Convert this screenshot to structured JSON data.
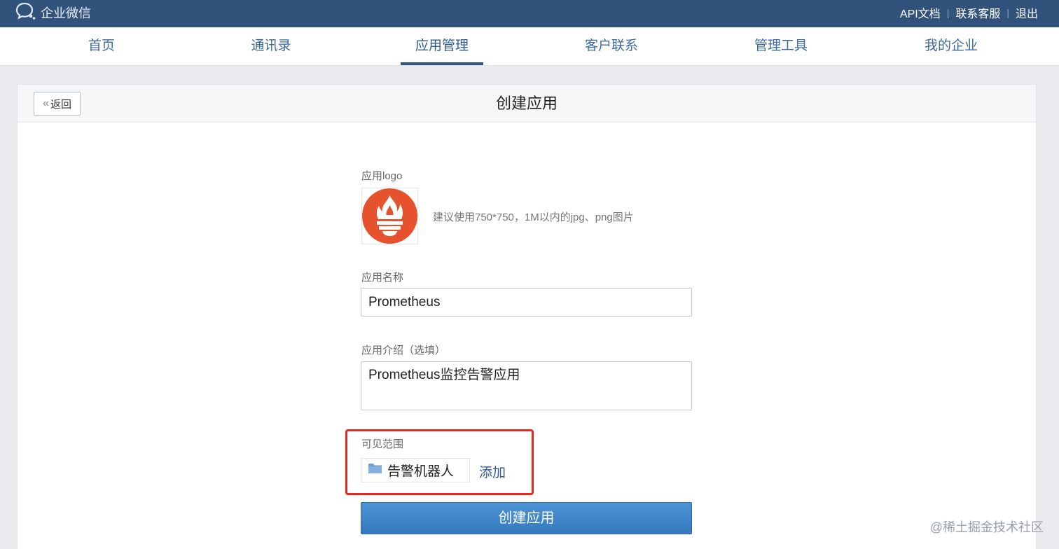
{
  "topbar": {
    "brand": "企业微信",
    "links": [
      "API文档",
      "联系客服",
      "退出"
    ]
  },
  "nav": {
    "items": [
      "首页",
      "通讯录",
      "应用管理",
      "客户联系",
      "管理工具",
      "我的企业"
    ],
    "active": "应用管理"
  },
  "panel": {
    "back_label": "返回",
    "title": "创建应用"
  },
  "form": {
    "logo_label": "应用logo",
    "logo_hint": "建议使用750*750，1M以内的jpg、png图片",
    "name_label": "应用名称",
    "name_value": "Prometheus",
    "desc_label": "应用介绍（选填）",
    "desc_value": "Prometheus监控告警应用",
    "scope_label": "可见范围",
    "scope_item": "告警机器人",
    "add_label": "添加",
    "submit_label": "创建应用"
  },
  "watermark": "@稀土掘金技术社区",
  "colors": {
    "topbar": "#31527b",
    "accent": "#2d5a8f",
    "logo": "#e6522c",
    "highlight": "#e8261d",
    "submit": "#3c86cb"
  }
}
